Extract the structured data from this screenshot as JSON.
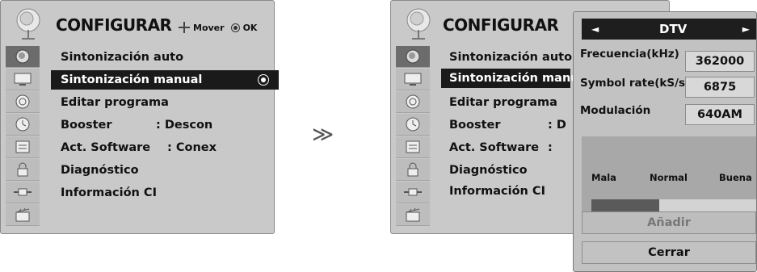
{
  "screen_a": {
    "title": "CONFIGURAR",
    "hint_move": "Mover",
    "hint_ok": "OK",
    "menu": [
      {
        "label": "Sintonización auto",
        "value": ""
      },
      {
        "label": "Sintonización manual",
        "value": ""
      },
      {
        "label": "Editar programa",
        "value": ""
      },
      {
        "label": "Booster",
        "value": ": Descon"
      },
      {
        "label": "Act. Software",
        "value": ": Conex"
      },
      {
        "label": "Diagnóstico",
        "value": ""
      },
      {
        "label": "Información CI",
        "value": ""
      }
    ],
    "selected_index": 1
  },
  "arrow": "≫",
  "screen_b": {
    "title": "CONFIGURAR",
    "menu": [
      {
        "label": "Sintonización auto",
        "value": ""
      },
      {
        "label": "Sintonización manual",
        "value": ""
      },
      {
        "label": "Editar programa",
        "value": ""
      },
      {
        "label": "Booster",
        "value": ": D"
      },
      {
        "label": "Act. Software",
        "value": ":"
      },
      {
        "label": "Diagnóstico",
        "value": ""
      },
      {
        "label": "Información CI",
        "value": ""
      }
    ],
    "selected_index": 1
  },
  "dtv_panel": {
    "header": "DTV",
    "left_arrow": "◄",
    "right_arrow": "►",
    "fields": [
      {
        "label": "Frecuencia(kHz)",
        "value": "362000"
      },
      {
        "label": "Symbol rate(kS/s)",
        "value": "6875"
      },
      {
        "label": "Modulación",
        "value": "640AM"
      }
    ],
    "signal": {
      "label_low": "Mala",
      "label_mid": "Normal",
      "label_high": "Buena",
      "level": 0.41
    },
    "add_button": "Añadir",
    "close_button": "Cerrar"
  },
  "sidebar_icons": [
    "satellite-icon",
    "tv-icon",
    "speaker-icon",
    "clock-icon",
    "keyboard-icon",
    "lock-icon",
    "plug-icon",
    "clapper-icon"
  ],
  "colors": {
    "selected_bg": "#1a1a1a",
    "screen_bg": "#c9c9c9",
    "active_icon_bg": "#6c6c6c"
  }
}
